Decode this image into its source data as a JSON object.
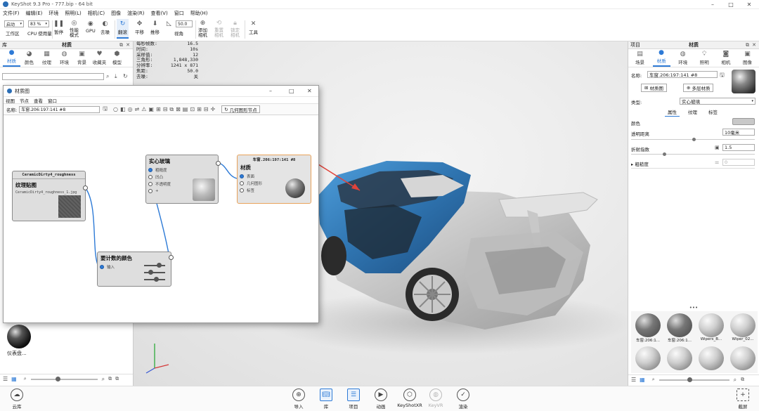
{
  "window": {
    "title": "KeyShot 9.3 Pro  -  777.bip  -  64 bit",
    "minimize": "–",
    "maximize": "□",
    "close": "✕"
  },
  "menubar": [
    "文件(F)",
    "编辑(E)",
    "环境",
    "照明(L)",
    "相机(C)",
    "图像",
    "渲染(R)",
    "查看(V)",
    "窗口",
    "帮助(H)"
  ],
  "toolbar": {
    "workspace_select": "启动",
    "zoom_select": "83 %",
    "focal_value": "50.0",
    "buttons": [
      {
        "label": "工作区",
        "icon": "workspace-icon"
      },
      {
        "label": "CPU 使用量",
        "icon": "cpu-icon"
      },
      {
        "label": "暂停",
        "icon": "pause-icon"
      },
      {
        "label": "性能\n模式",
        "icon": "performance-icon"
      },
      {
        "label": "GPU",
        "icon": "gpu-icon"
      },
      {
        "label": "去噪",
        "icon": "denoise-icon"
      },
      {
        "label": "翻滚",
        "icon": "tumble-icon"
      },
      {
        "label": "平移",
        "icon": "pan-icon"
      },
      {
        "label": "推移",
        "icon": "dolly-icon"
      },
      {
        "label": "视角",
        "icon": "view-angle-icon"
      },
      {
        "label": "添加\n相机",
        "icon": "add-camera-icon"
      },
      {
        "label": "重置\n相机",
        "icon": "reset-camera-icon"
      },
      {
        "label": "锁定\n相机",
        "icon": "lock-camera-icon"
      },
      {
        "label": "工具",
        "icon": "tools-icon"
      }
    ]
  },
  "library": {
    "panel_title": "库",
    "header_title": "材质",
    "tabs": [
      {
        "label": "材质",
        "icon": "material-icon"
      },
      {
        "label": "颜色",
        "icon": "color-icon"
      },
      {
        "label": "纹理",
        "icon": "texture-icon"
      },
      {
        "label": "环境",
        "icon": "environment-icon"
      },
      {
        "label": "背景",
        "icon": "background-icon"
      },
      {
        "label": "收藏夹",
        "icon": "favorites-icon"
      },
      {
        "label": "模型",
        "icon": "model-icon"
      }
    ],
    "search_placeholder": "",
    "thumb_label": "仪表盘..."
  },
  "stats": [
    {
      "k": "每秒帧数:",
      "v": "16.5"
    },
    {
      "k": "时间:",
      "v": "10s"
    },
    {
      "k": "采样值:",
      "v": "12"
    },
    {
      "k": "三角形:",
      "v": "1,848,330"
    },
    {
      "k": "分辨率:",
      "v": "1241 x 871"
    },
    {
      "k": "焦距:",
      "v": "50.0"
    },
    {
      "k": "去噪:",
      "v": "关"
    }
  ],
  "material_graph": {
    "title": "材质图",
    "menu": [
      "视图",
      "节点",
      "查看",
      "窗口"
    ],
    "name_label": "名称:",
    "name_value": "车窗.206:197:141 #8",
    "geometry_button": "几何图形节点",
    "nodes": {
      "texture": {
        "header": "CeramicDirty4_roughness",
        "title": "纹理贴图",
        "file": "CeramicDirty4_roughness_1.jpg"
      },
      "glass": {
        "title": "实心玻璃",
        "ports": [
          "粗糙度",
          "凹凸",
          "不透明度",
          "+"
        ]
      },
      "material": {
        "header": "车窗.206:197:141 #8",
        "title": "材质",
        "ports": [
          "表面",
          "几何图形",
          "标签"
        ]
      },
      "curve": {
        "title": "要计数的颜色",
        "ports": [
          "输入"
        ]
      }
    }
  },
  "project": {
    "panel_title": "项目",
    "header_title": "材质",
    "tabs": [
      {
        "label": "场景",
        "icon": "scene-icon"
      },
      {
        "label": "材质",
        "icon": "material-icon"
      },
      {
        "label": "环境",
        "icon": "environment-icon"
      },
      {
        "label": "照明",
        "icon": "lighting-icon"
      },
      {
        "label": "相机",
        "icon": "camera-icon"
      },
      {
        "label": "图像",
        "icon": "image-icon"
      }
    ],
    "name_label": "名称:",
    "name_value": "车窗.206:197:141 #8",
    "material_graph_button": "材质图",
    "multilayer_button": "多层材质",
    "type_label": "类型:",
    "type_value": "实心玻璃",
    "subtabs": [
      "属性",
      "纹理",
      "标签"
    ],
    "color_label": "颜色",
    "color_swatch": "#c8c8c8",
    "transparency_label": "透明距离",
    "transparency_value": "10毫米",
    "ior_label": "折射指数",
    "ior_value": "1.5",
    "roughness_label": "粗糙度",
    "roughness_value": "0",
    "material_thumbs": [
      "车窗:206:1...",
      "车窗:206:1...",
      "Wipers_B...",
      "Wiper_02...",
      "",
      "",
      "",
      ""
    ]
  },
  "bottombar": {
    "left": {
      "label": "云库",
      "icon": "cloud-library-icon"
    },
    "center": [
      {
        "label": "导入",
        "icon": "import-icon",
        "selected": false,
        "dim": false
      },
      {
        "label": "库",
        "icon": "library-icon",
        "selected": true,
        "dim": false
      },
      {
        "label": "项目",
        "icon": "project-icon",
        "selected": true,
        "dim": false
      },
      {
        "label": "动画",
        "icon": "animation-icon",
        "selected": false,
        "dim": false
      },
      {
        "label": "KeyShotXR",
        "icon": "keyshotxr-icon",
        "selected": false,
        "dim": false
      },
      {
        "label": "KeyVR",
        "icon": "keyvr-icon",
        "selected": false,
        "dim": true
      },
      {
        "label": "渲染",
        "icon": "render-icon",
        "selected": false,
        "dim": false
      }
    ],
    "right": {
      "label": "截屏",
      "icon": "screenshot-icon"
    }
  },
  "colors": {
    "accent": "#2d7ad6",
    "car_blue": "#2f74b0",
    "node_orange": "#e8a25a"
  }
}
